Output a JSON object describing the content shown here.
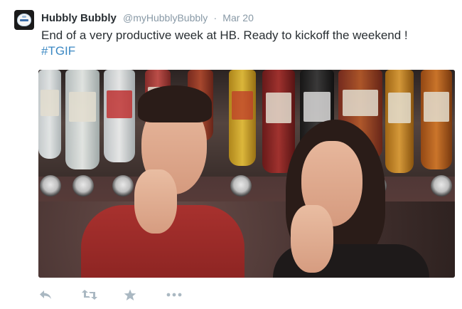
{
  "tweet": {
    "author_name": "Hubbly Bubbly",
    "handle": "@myHubblyBubbly",
    "separator": "·",
    "date": "Mar 20",
    "text": "End of a very productive week at HB. Ready to kickoff the weekend !",
    "hashtag": "#TGIF"
  },
  "icons": {
    "avatar": "hubbly-bubbly-logo",
    "actions": [
      "reply-icon",
      "retweet-icon",
      "favorite-icon",
      "more-icon"
    ]
  },
  "colors": {
    "name": "#292f33",
    "meta": "#8899a6",
    "link": "#3b88c3",
    "action_icon": "#aab8c2"
  }
}
